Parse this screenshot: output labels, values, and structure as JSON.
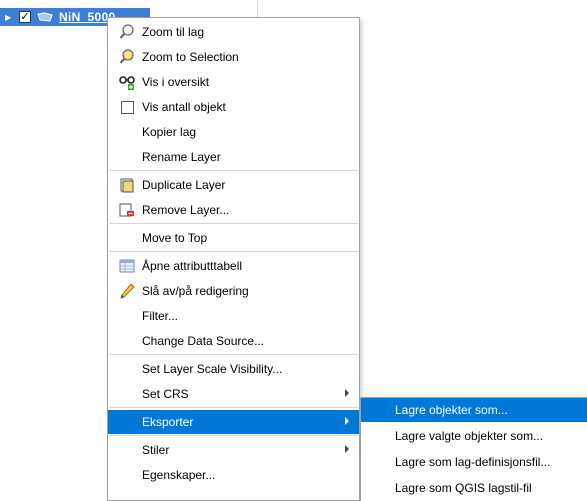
{
  "layer": {
    "name": "NiN_5000",
    "checked": "✓"
  },
  "menu": {
    "items": [
      {
        "label": "Zoom til lag",
        "icon": "zoom-icon"
      },
      {
        "label": "Zoom to Selection",
        "icon": "zoom-selection-icon"
      },
      {
        "label": "Vis i oversikt",
        "icon": "overview-icon"
      },
      {
        "label": "Vis antall objekt",
        "icon": "checkbox-icon"
      },
      {
        "label": "Kopier lag",
        "icon": ""
      },
      {
        "label": "Rename Layer",
        "icon": ""
      },
      {
        "label": "Duplicate Layer",
        "icon": "duplicate-icon"
      },
      {
        "label": "Remove Layer...",
        "icon": "remove-icon"
      },
      {
        "label": "Move to Top",
        "icon": ""
      },
      {
        "label": "Åpne attributttabell",
        "icon": "table-icon"
      },
      {
        "label": "Slå av/på redigering",
        "icon": "pencil-icon"
      },
      {
        "label": "Filter...",
        "icon": ""
      },
      {
        "label": "Change Data Source...",
        "icon": ""
      },
      {
        "label": "Set Layer Scale Visibility...",
        "icon": ""
      },
      {
        "label": "Set CRS",
        "icon": ""
      },
      {
        "label": "Eksporter",
        "icon": ""
      },
      {
        "label": "Stiler",
        "icon": ""
      },
      {
        "label": "Egenskaper...",
        "icon": ""
      }
    ]
  },
  "submenu": {
    "items": [
      {
        "label": "Lagre objekter som..."
      },
      {
        "label": "Lagre valgte objekter som..."
      },
      {
        "label": "Lagre som lag-definisjonsfil..."
      },
      {
        "label": "Lagre som QGIS lagstil-fil"
      }
    ]
  },
  "colors": {
    "highlight": "#0078d7",
    "layer_row": "#3d7fd6"
  }
}
